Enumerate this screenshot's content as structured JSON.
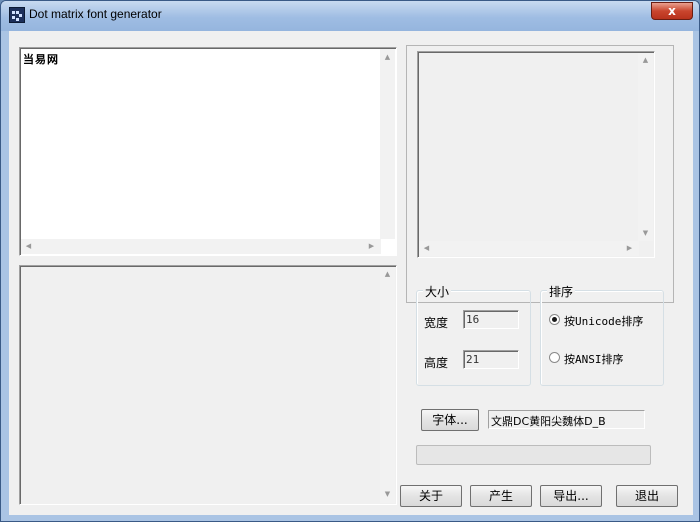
{
  "window": {
    "title": "Dot matrix font generator",
    "close_glyph": "x"
  },
  "input": {
    "text": "当易网"
  },
  "size_group": {
    "legend": "大小",
    "width_label": "宽度",
    "width_value": "16",
    "height_label": "高度",
    "height_value": "21"
  },
  "order_group": {
    "legend": "排序",
    "options": [
      {
        "label": "按Unicode排序",
        "selected": true
      },
      {
        "label": "按ANSI排序",
        "selected": false
      }
    ]
  },
  "font": {
    "button_label": "字体...",
    "current": "文鼎DC黄阳尖魏体D_B"
  },
  "progress": {
    "value": 0
  },
  "actions": {
    "about": "关于",
    "generate": "产生",
    "export": "导出...",
    "exit": "退出"
  }
}
